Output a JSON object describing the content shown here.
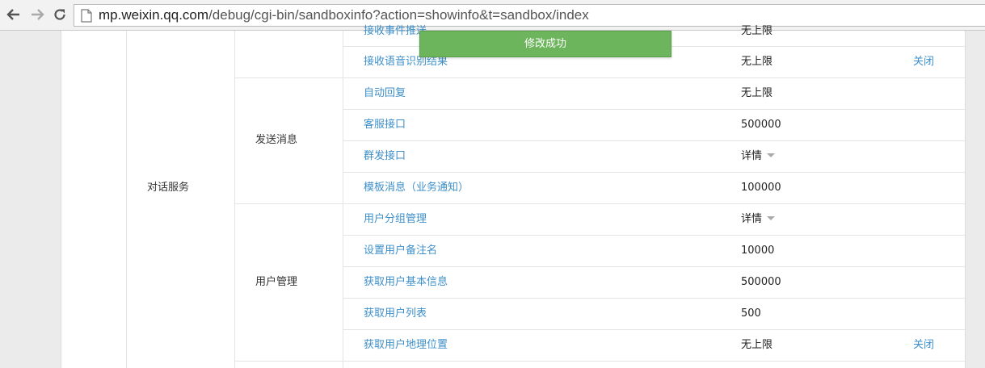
{
  "browser": {
    "url_host": "mp.weixin.qq.com",
    "url_path": "/debug/cgi-bin/sandboxinfo?action=showinfo&t=sandbox/index"
  },
  "toast": {
    "message": "修改成功"
  },
  "table": {
    "category": "对话服务",
    "groups": [
      {
        "label": "发送消息"
      },
      {
        "label": "用户管理"
      }
    ],
    "rows": [
      {
        "name": "接收事件推送",
        "value": "无上限",
        "action": ""
      },
      {
        "name": "接收语音识别结果",
        "value": "无上限",
        "action": "关闭"
      },
      {
        "name": "自动回复",
        "value": "无上限",
        "action": ""
      },
      {
        "name": "客服接口",
        "value": "500000",
        "action": ""
      },
      {
        "name": "群发接口",
        "value": "详情",
        "action": ""
      },
      {
        "name": "模板消息（业务通知）",
        "value": "100000",
        "action": ""
      },
      {
        "name": "用户分组管理",
        "value": "详情",
        "action": ""
      },
      {
        "name": "设置用户备注名",
        "value": "10000",
        "action": ""
      },
      {
        "name": "获取用户基本信息",
        "value": "500000",
        "action": ""
      },
      {
        "name": "获取用户列表",
        "value": "500",
        "action": ""
      },
      {
        "name": "获取用户地理位置",
        "value": "无上限",
        "action": "关闭"
      }
    ]
  }
}
